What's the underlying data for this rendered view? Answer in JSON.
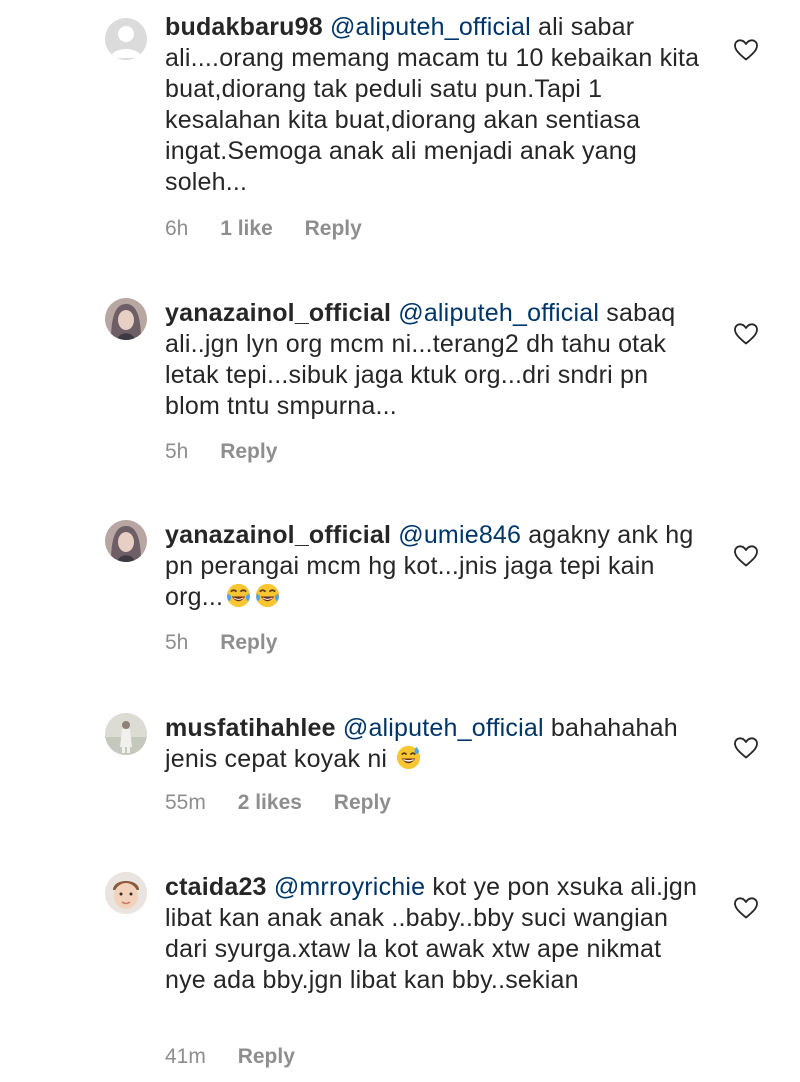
{
  "comments": [
    {
      "username": "budakbaru98",
      "mention": "@aliputeh_official",
      "text": "ali sabar ali....orang memang macam tu 10 kebaikan kita buat,diorang tak peduli satu pun.Tapi 1 kesalahan kita buat,diorang akan sentiasa ingat.Semoga anak ali menjadi anak yang soleh...",
      "time": "6h",
      "likes": "1 like",
      "reply": "Reply",
      "avatar": "default-avatar-icon"
    },
    {
      "username": "yanazainol_official",
      "mention": "@aliputeh_official",
      "text": "sabaq ali..jgn lyn org mcm ni...terang2 dh tahu otak letak tepi...sibuk jaga ktuk org...dri sndri pn blom tntu smpurna...",
      "time": "5h",
      "likes": "",
      "reply": "Reply",
      "avatar": "user-photo"
    },
    {
      "username": "yanazainol_official",
      "mention": "@umie846",
      "text": "agakny ank hg pn perangai mcm hg kot...jnis jaga tepi kain org...",
      "time": "5h",
      "likes": "",
      "reply": "Reply",
      "avatar": "user-photo",
      "emojis": [
        "tears-of-joy-emoji",
        "tears-of-joy-emoji"
      ]
    },
    {
      "username": "musfatihahlee",
      "mention": "@aliputeh_official",
      "text": "bahahahah jenis cepat koyak ni",
      "time": "55m",
      "likes": "2 likes",
      "reply": "Reply",
      "avatar": "user-photo",
      "emojis": [
        "grinning-sweat-emoji"
      ]
    },
    {
      "username": "ctaida23",
      "mention": "@mrroyrichie",
      "text": "kot ye pon xsuka ali.jgn libat kan anak anak ..baby..bby suci wangian dari syurga.xtaw la kot awak xtw ape nikmat nye ada bby.jgn libat kan bby..sekian",
      "time": "41m",
      "likes": "",
      "reply": "Reply",
      "avatar": "user-photo"
    }
  ]
}
